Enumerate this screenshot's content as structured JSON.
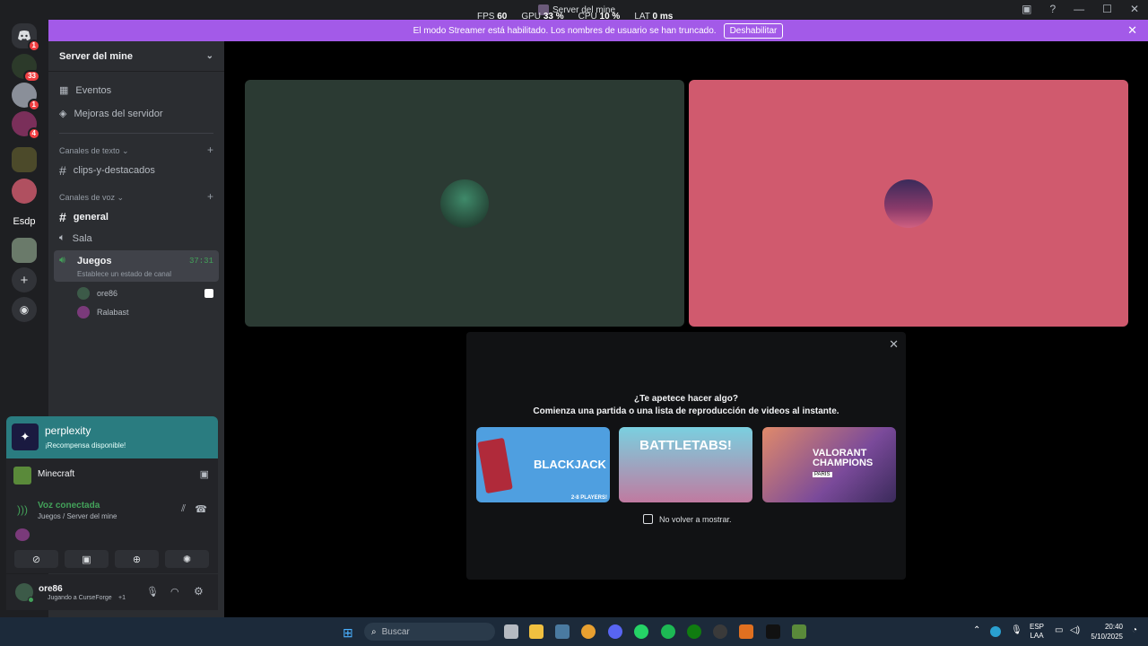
{
  "topbar": {
    "window_title": "Server del mine",
    "stats": {
      "fps_label": "FPS",
      "fps": "60",
      "gpu_label": "GPU",
      "gpu": "33 %",
      "cpu_label": "CPU",
      "cpu": "10 %",
      "lat_label": "LAT",
      "lat": "0 ms"
    }
  },
  "banner": {
    "message": "El modo Streamer está habilitado. Los nombres de usuario se han truncado.",
    "button": "Deshabilitar"
  },
  "rail": {
    "servers": [
      {
        "badge": "1"
      },
      {
        "badge": "33"
      },
      {
        "badge": "1"
      },
      {
        "badge": "4"
      },
      {
        "badge": ""
      },
      {
        "badge": ""
      },
      {
        "label": "Esdp"
      },
      {
        "badge": ""
      }
    ]
  },
  "sidebar": {
    "server_name": "Server del mine",
    "events": "Eventos",
    "boosts": "Mejoras del servidor",
    "text_category": "Canales de texto",
    "text_channels": [
      "clips-y-destacados"
    ],
    "voice_category": "Canales de voz",
    "voice_channels": [
      "general",
      "Sala"
    ],
    "active_channel": {
      "name": "Juegos",
      "timer": "37:31",
      "status": "Establece un estado de canal"
    },
    "members": [
      "ore86",
      "Ralabast"
    ]
  },
  "panels": {
    "promo_title": "perplexity",
    "promo_sub": "¡Recompensa disponible!",
    "game": "Minecraft",
    "voice_status": "Voz conectada",
    "voice_location": "Juegos / Server del mine",
    "username": "ore86",
    "user_activity": "Jugando a CurseForge",
    "user_activity_extra": "+1"
  },
  "activity": {
    "title": "¿Te apetece hacer algo?",
    "subtitle": "Comienza una partida o una lista de reproducción de videos al instante.",
    "cards": [
      {
        "name": "BLACKJACK",
        "tag": "2-8 PLAYERS!"
      },
      {
        "name": "BATTLETABS!"
      },
      {
        "name": "VALORANT CHAMPIONS",
        "tag": "PARIS"
      }
    ],
    "checkbox_label": "No volver a mostrar."
  },
  "taskbar": {
    "search": "Buscar",
    "lang": "ESP",
    "layout": "LAA",
    "time": "20:40",
    "date": "5/10/2025"
  },
  "colors": {
    "banner": "#a35ae8",
    "tile1": "#2b3a33",
    "tile2": "#d05a6e",
    "green": "#43a25a"
  }
}
